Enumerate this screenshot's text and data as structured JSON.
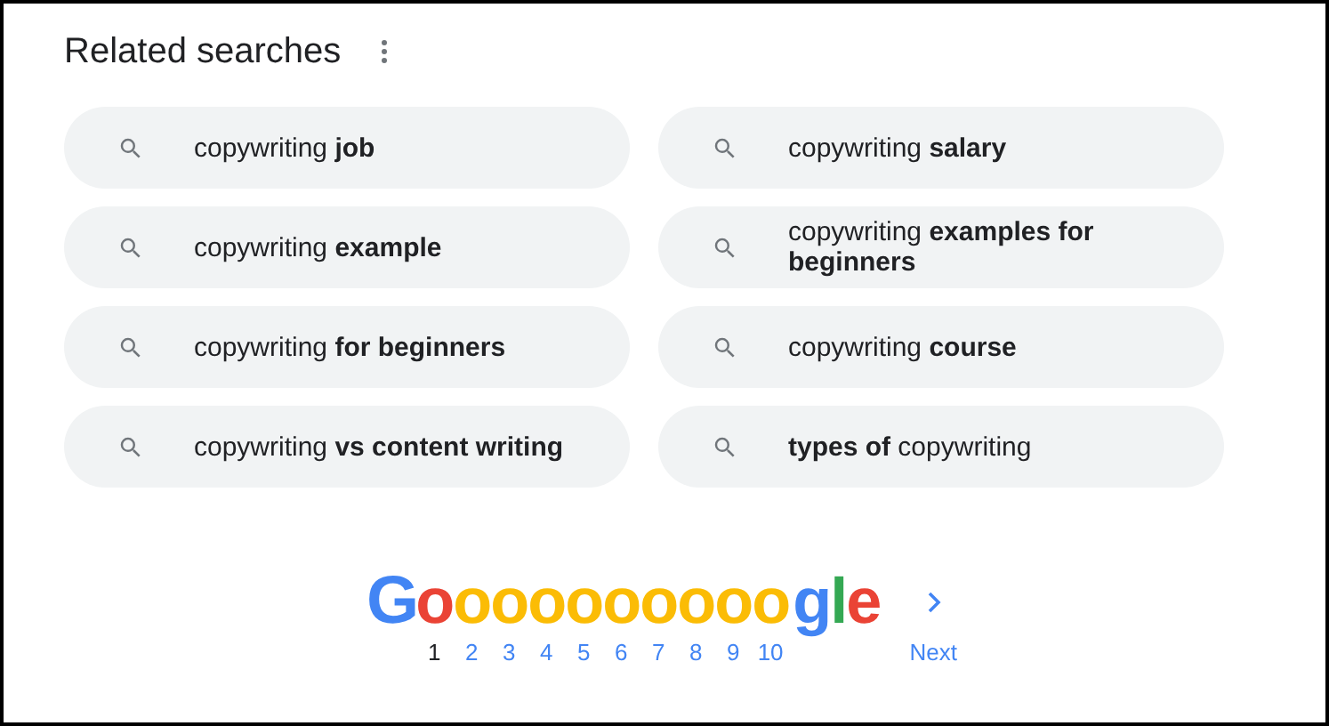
{
  "title": "Related searches",
  "searches": [
    {
      "text": "copywriting **job**"
    },
    {
      "text": "copywriting **salary**"
    },
    {
      "text": "copywriting **example**"
    },
    {
      "text": "copywriting **examples for beginners**"
    },
    {
      "text": "copywriting **for beginners**"
    },
    {
      "text": "copywriting **course**"
    },
    {
      "text": "copywriting **vs content writing**"
    },
    {
      "text": "**types of** copywriting"
    }
  ],
  "logo": [
    {
      "letter": "G",
      "color": "#4285f4"
    },
    {
      "letter": "o",
      "color": "#ea4335"
    },
    {
      "letter": "o",
      "color": "#fbbc05"
    },
    {
      "letter": "o",
      "color": "#fbbc05"
    },
    {
      "letter": "o",
      "color": "#fbbc05"
    },
    {
      "letter": "o",
      "color": "#fbbc05"
    },
    {
      "letter": "o",
      "color": "#fbbc05"
    },
    {
      "letter": "o",
      "color": "#fbbc05"
    },
    {
      "letter": "o",
      "color": "#fbbc05"
    },
    {
      "letter": "o",
      "color": "#fbbc05"
    },
    {
      "letter": "o",
      "color": "#fbbc05"
    },
    {
      "letter": "g",
      "color": "#4285f4"
    },
    {
      "letter": "l",
      "color": "#34a853"
    },
    {
      "letter": "e",
      "color": "#ea4335"
    }
  ],
  "pages": [
    {
      "label": "1",
      "selected": true
    },
    {
      "label": "2",
      "selected": false
    },
    {
      "label": "3",
      "selected": false
    },
    {
      "label": "4",
      "selected": false
    },
    {
      "label": "5",
      "selected": false
    },
    {
      "label": "6",
      "selected": false
    },
    {
      "label": "7",
      "selected": false
    },
    {
      "label": "8",
      "selected": false
    },
    {
      "label": "9",
      "selected": false
    },
    {
      "label": "10",
      "selected": false
    }
  ],
  "next": "Next"
}
